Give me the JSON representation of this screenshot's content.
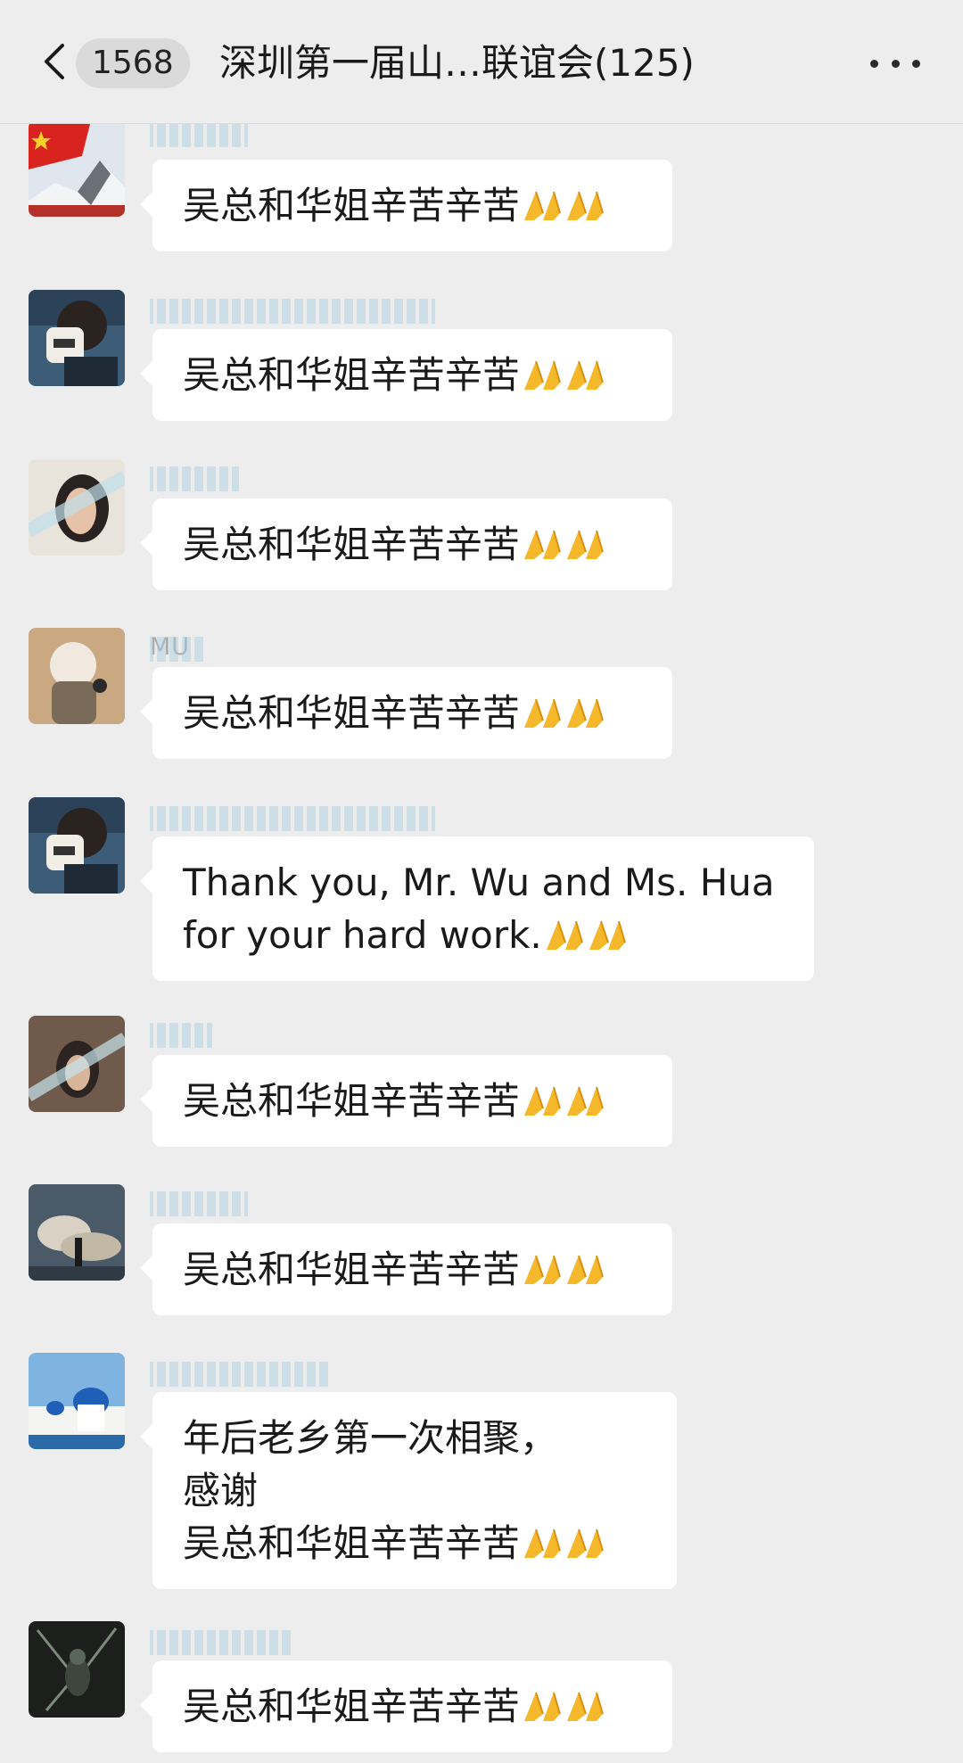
{
  "header": {
    "back_icon": "chevron-left-icon",
    "unread_count": "1568",
    "title": "深圳第一届山…联谊会(125)",
    "more_icon": "more-dots-icon"
  },
  "messages": [
    {
      "sender": "",
      "lines": [
        "吴总和华姐辛苦辛苦"
      ],
      "emoji": "folded-hands-icon"
    },
    {
      "sender": "",
      "lines": [
        "吴总和华姐辛苦辛苦"
      ],
      "emoji": "folded-hands-icon"
    },
    {
      "sender": "",
      "lines": [
        "吴总和华姐辛苦辛苦"
      ],
      "emoji": "folded-hands-icon"
    },
    {
      "sender": "MU",
      "lines": [
        "吴总和华姐辛苦辛苦"
      ],
      "emoji": "folded-hands-icon"
    },
    {
      "sender": "",
      "lines": [
        "Thank you, Mr. Wu and Ms. Hua",
        "for your hard work."
      ],
      "emoji": "folded-hands-icon"
    },
    {
      "sender": "",
      "lines": [
        "吴总和华姐辛苦辛苦"
      ],
      "emoji": "folded-hands-icon"
    },
    {
      "sender": "",
      "lines": [
        "吴总和华姐辛苦辛苦"
      ],
      "emoji": "folded-hands-icon"
    },
    {
      "sender": "",
      "lines": [
        "年后老乡第一次相聚，",
        "感谢",
        "吴总和华姐辛苦辛苦"
      ],
      "emoji": "folded-hands-icon"
    },
    {
      "sender": "",
      "lines": [
        "吴总和华姐辛苦辛苦"
      ],
      "emoji": "folded-hands-icon"
    }
  ]
}
